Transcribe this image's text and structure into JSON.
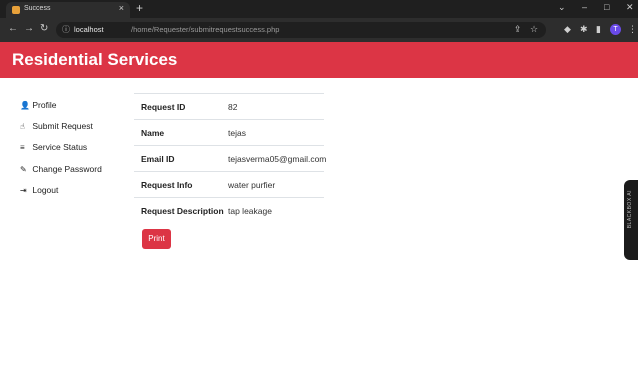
{
  "browser": {
    "tab_title": "Success",
    "tab_close": "×",
    "new_tab": "+",
    "url_host": "localhost",
    "url_path": "/home/Requester/submitrequestsuccess.php",
    "window_controls": [
      "⌄",
      "–",
      "□",
      "✕"
    ],
    "avatar_initial": "T"
  },
  "header": {
    "title": "Residential Services",
    "bg_color": "#dc3545"
  },
  "sidebar": {
    "items": [
      {
        "icon": "user-icon",
        "glyph": "👤",
        "label": "Profile"
      },
      {
        "icon": "hand-icon",
        "glyph": "☝",
        "label": "Submit Request"
      },
      {
        "icon": "align-icon",
        "glyph": "≡",
        "label": "Service Status"
      },
      {
        "icon": "key-icon",
        "glyph": "✎",
        "label": "Change Password"
      },
      {
        "icon": "sign-out-icon",
        "glyph": "⇥",
        "label": "Logout"
      }
    ]
  },
  "request": {
    "rows": [
      {
        "label": "Request ID",
        "value": "82"
      },
      {
        "label": "Name",
        "value": "tejas"
      },
      {
        "label": "Email ID",
        "value": "tejasverma05@gmail.com"
      },
      {
        "label": "Request Info",
        "value": "water purfier"
      },
      {
        "label": "Request Description",
        "value": "tap leakage"
      }
    ],
    "print_label": "Print"
  },
  "widget": {
    "text": "BLACKBOX AI"
  }
}
